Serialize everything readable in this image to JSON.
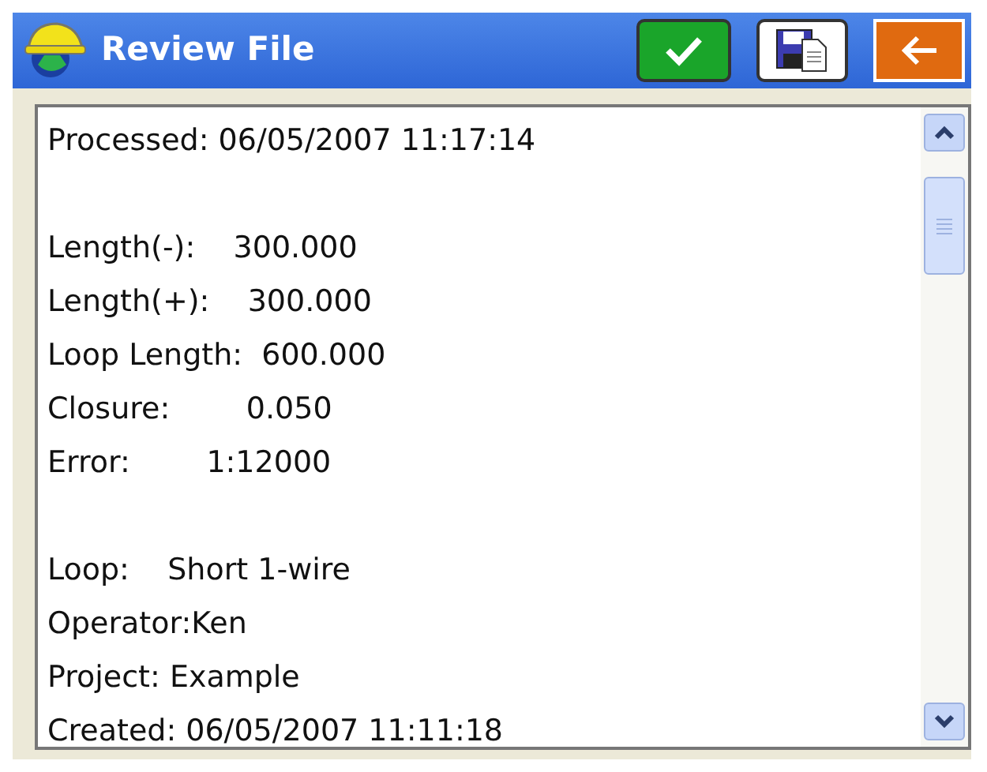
{
  "window": {
    "title": "Review File"
  },
  "toolbar": {
    "buttons": [
      {
        "kind": "accept"
      },
      {
        "kind": "save"
      },
      {
        "kind": "back"
      }
    ]
  },
  "report": {
    "sections": [
      {
        "lines": [
          "Processed: 06/05/2007 11:17:14"
        ]
      },
      {
        "lines": [
          "Length(-):    300.000",
          "Length(+):    300.000",
          "Loop Length:  600.000",
          "Closure:        0.050",
          "Error:        1:12000"
        ]
      },
      {
        "lines": [
          "Loop:    Short 1-wire",
          "Operator:Ken",
          "Project: Example",
          "Created: 06/05/2007 11:11:18"
        ]
      }
    ]
  }
}
